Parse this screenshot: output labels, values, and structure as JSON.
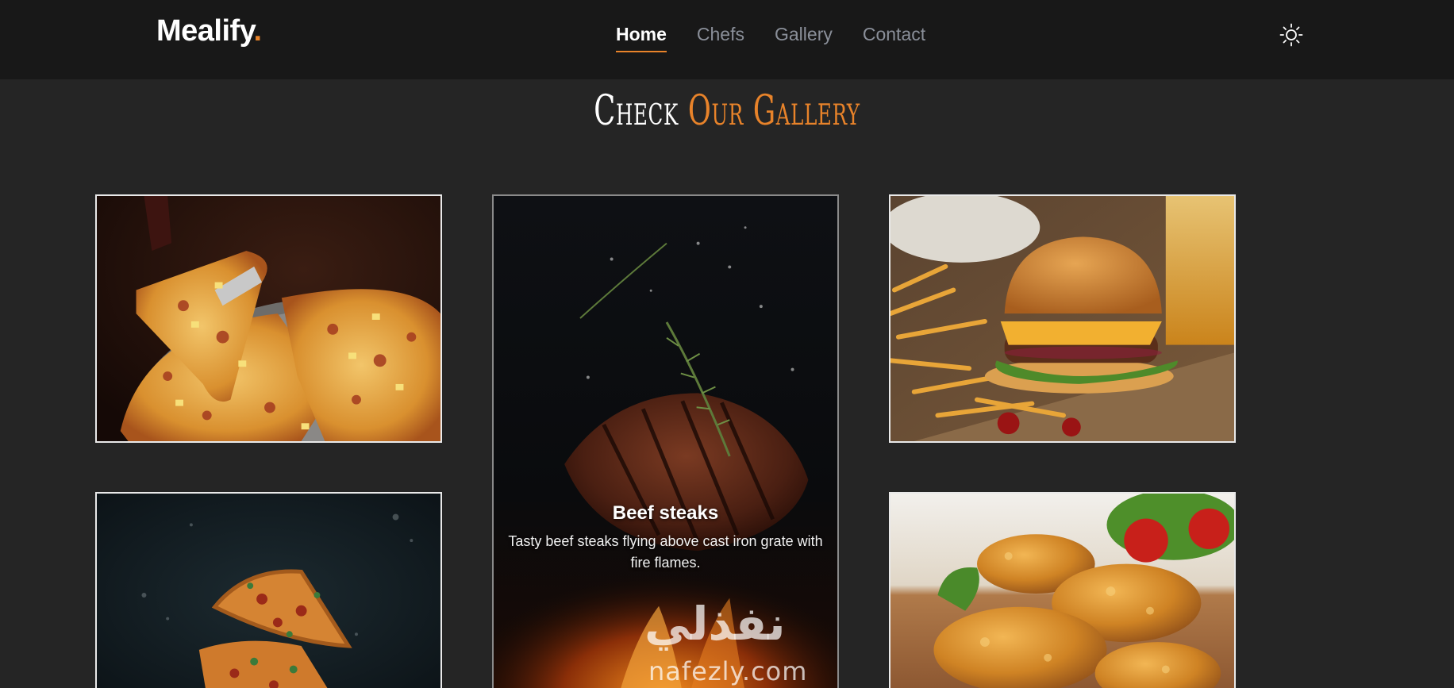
{
  "header": {
    "logo_text": "Mealify",
    "logo_dot": ".",
    "nav": [
      {
        "label": "Home",
        "active": true
      },
      {
        "label": "Chefs",
        "active": false
      },
      {
        "label": "Gallery",
        "active": false
      },
      {
        "label": "Contact",
        "active": false
      }
    ],
    "theme_icon": "sun-icon"
  },
  "section": {
    "title_part1": "Check",
    "title_part2": "Our Gallery"
  },
  "gallery": {
    "items": [
      {
        "image": "pizza-slice-lift",
        "title": "",
        "description": ""
      },
      {
        "image": "beef-steak-flames",
        "title": "Beef steaks",
        "description": "Tasty beef steaks flying above cast iron grate with fire flames."
      },
      {
        "image": "burger-and-fries",
        "title": "",
        "description": ""
      },
      {
        "image": "flying-pizza-slices",
        "title": "",
        "description": ""
      },
      {
        "image": "fried-chicken",
        "title": "",
        "description": ""
      }
    ],
    "watermark_arabic": "نفذلي",
    "watermark_latin": "nafezly.com"
  },
  "colors": {
    "accent": "#e8832a",
    "header_bg": "#181818",
    "page_bg": "#252525",
    "nav_inactive": "#8a8f99"
  }
}
